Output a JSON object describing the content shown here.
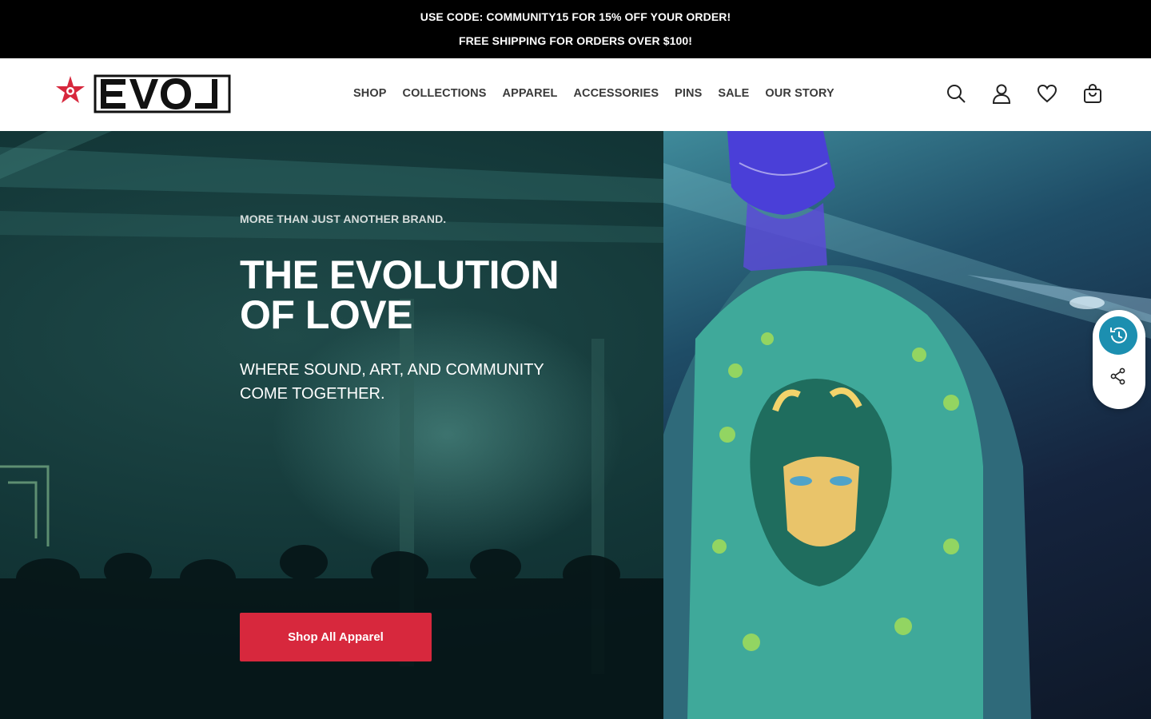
{
  "announcement": {
    "line1": "USE CODE: COMMUNITY15 FOR 15% OFF YOUR ORDER!",
    "line2": "FREE SHIPPING FOR ORDERS OVER $100!"
  },
  "brand": {
    "name": "EVOL",
    "accent": "#d7283d"
  },
  "nav": {
    "items": [
      {
        "label": "SHOP"
      },
      {
        "label": "COLLECTIONS"
      },
      {
        "label": "APPAREL"
      },
      {
        "label": "ACCESSORIES"
      },
      {
        "label": "PINS"
      },
      {
        "label": "SALE"
      },
      {
        "label": "OUR STORY"
      }
    ]
  },
  "header_icons": [
    "search-icon",
    "account-icon",
    "wishlist-icon",
    "cart-icon"
  ],
  "hero": {
    "eyebrow": "MORE THAN JUST ANOTHER BRAND.",
    "headline_line1": "THE EVOLUTION",
    "headline_line2": "OF LOVE",
    "sub_line1": "WHERE SOUND, ART, AND COMMUNITY",
    "sub_line2": "COME TOGETHER.",
    "cta_label": "Shop All Apparel"
  },
  "floating": {
    "history_icon": "history-icon",
    "share_icon": "share-icon",
    "history_color": "#1c8fb0"
  }
}
